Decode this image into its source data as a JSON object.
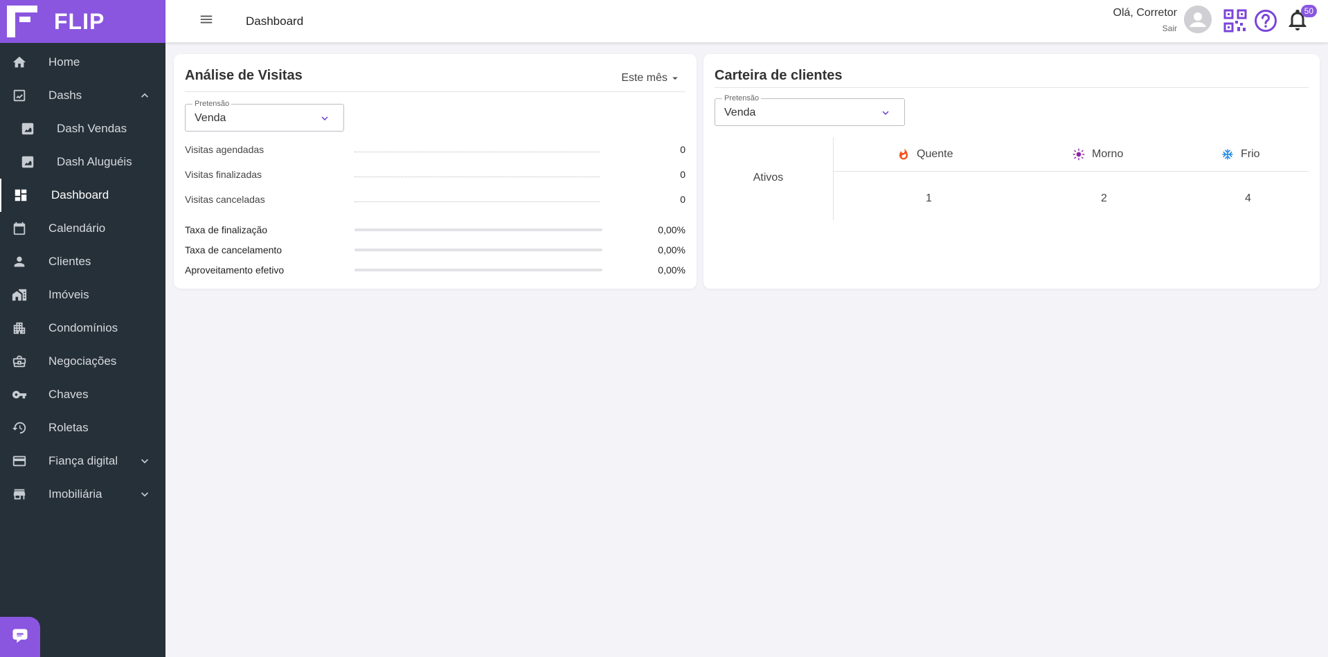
{
  "brand": {
    "name": "FLIP",
    "color": "#8a56e0"
  },
  "sidebar": {
    "items": [
      {
        "label": "Home",
        "icon": "home-icon"
      },
      {
        "label": "Dashs",
        "icon": "chart-icon",
        "expanded": true
      },
      {
        "label": "Dash Vendas",
        "icon": "chart-box-icon"
      },
      {
        "label": "Dash Aluguéis",
        "icon": "chart-box-icon"
      },
      {
        "label": "Dashboard",
        "icon": "dashboard-icon",
        "active": true
      },
      {
        "label": "Calendário",
        "icon": "calendar-icon"
      },
      {
        "label": "Clientes",
        "icon": "person-icon"
      },
      {
        "label": "Imóveis",
        "icon": "buildings-icon"
      },
      {
        "label": "Condomínios",
        "icon": "apartment-icon"
      },
      {
        "label": "Negociações",
        "icon": "briefcase-icon"
      },
      {
        "label": "Chaves",
        "icon": "key-icon"
      },
      {
        "label": "Roletas",
        "icon": "rotate-icon"
      },
      {
        "label": "Fiança digital",
        "icon": "card-icon",
        "expanded": false
      },
      {
        "label": "Imobiliária",
        "icon": "store-icon",
        "expanded": false
      }
    ]
  },
  "header": {
    "title": "Dashboard",
    "greeting": "Olá, Corretor",
    "logout": "Sair",
    "notifications": "50"
  },
  "visitas": {
    "title": "Análise de Visitas",
    "period": "Este mês",
    "pretensao_label": "Pretensão",
    "pretensao_value": "Venda",
    "stats": [
      {
        "label": "Visitas agendadas",
        "value": "0"
      },
      {
        "label": "Visitas finalizadas",
        "value": "0"
      },
      {
        "label": "Visitas canceladas",
        "value": "0"
      }
    ],
    "rates": [
      {
        "label": "Taxa de finalização",
        "value": "0,00%",
        "fraction": 0
      },
      {
        "label": "Taxa de cancelamento",
        "value": "0,00%",
        "fraction": 0
      },
      {
        "label": "Aproveitamento efetivo",
        "value": "0,00%",
        "fraction": 0
      }
    ]
  },
  "carteira": {
    "title": "Carteira de clientes",
    "pretensao_label": "Pretensão",
    "pretensao_value": "Venda",
    "row_label": "Ativos",
    "columns": [
      {
        "label": "Quente",
        "icon": "fire-icon",
        "color": "#f4511e",
        "value": "1"
      },
      {
        "label": "Morno",
        "icon": "sun-icon",
        "color": "#8e24aa",
        "value": "2"
      },
      {
        "label": "Frio",
        "icon": "snowflake-icon",
        "color": "#1e88e5",
        "value": "4"
      }
    ]
  }
}
